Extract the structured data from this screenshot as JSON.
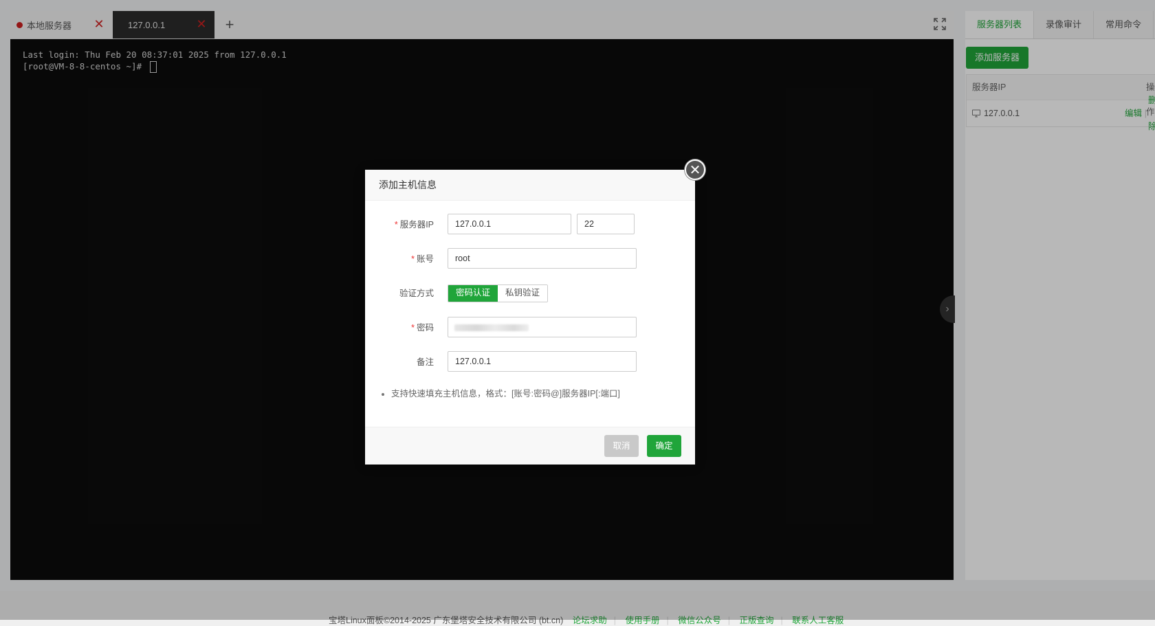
{
  "terminal": {
    "tabs": [
      {
        "label": "本地服务器"
      },
      {
        "label": "127.0.0.1"
      }
    ],
    "lines": [
      "Last login: Thu Feb 20 08:37:01 2025 from 127.0.0.1",
      "[root@VM-8-8-centos ~]# "
    ]
  },
  "side": {
    "tabs": [
      "服务器列表",
      "录像审计",
      "常用命令"
    ],
    "add_button": "添加服务器",
    "table": {
      "header_ip": "服务器IP",
      "header_op": "操作",
      "rows": [
        {
          "ip": "127.0.0.1",
          "edit": "编辑",
          "sep": "|",
          "delete": "删除"
        }
      ]
    }
  },
  "modal": {
    "title": "添加主机信息",
    "fields": {
      "server_ip": {
        "label": "服务器IP",
        "value": "127.0.0.1"
      },
      "port": {
        "value": "22"
      },
      "account": {
        "label": "账号",
        "value": "root"
      },
      "auth": {
        "label": "验证方式",
        "options": [
          "密码认证",
          "私钥验证"
        ],
        "selected": "密码认证"
      },
      "password": {
        "label": "密码"
      },
      "remark": {
        "label": "备注",
        "value": "127.0.0.1"
      }
    },
    "tip": "支持快速填充主机信息，格式：[账号:密码@]服务器IP[:端口]",
    "cancel": "取消",
    "confirm": "确定"
  },
  "footer": {
    "copyright": "宝塔Linux面板©2014-2025 广东堡塔安全技术有限公司 (bt.cn)",
    "links": [
      "论坛求助",
      "使用手册",
      "微信公众号",
      "正版查询",
      "联系人工客服"
    ]
  },
  "colors": {
    "accent": "#20a53a",
    "danger": "#d02020"
  }
}
